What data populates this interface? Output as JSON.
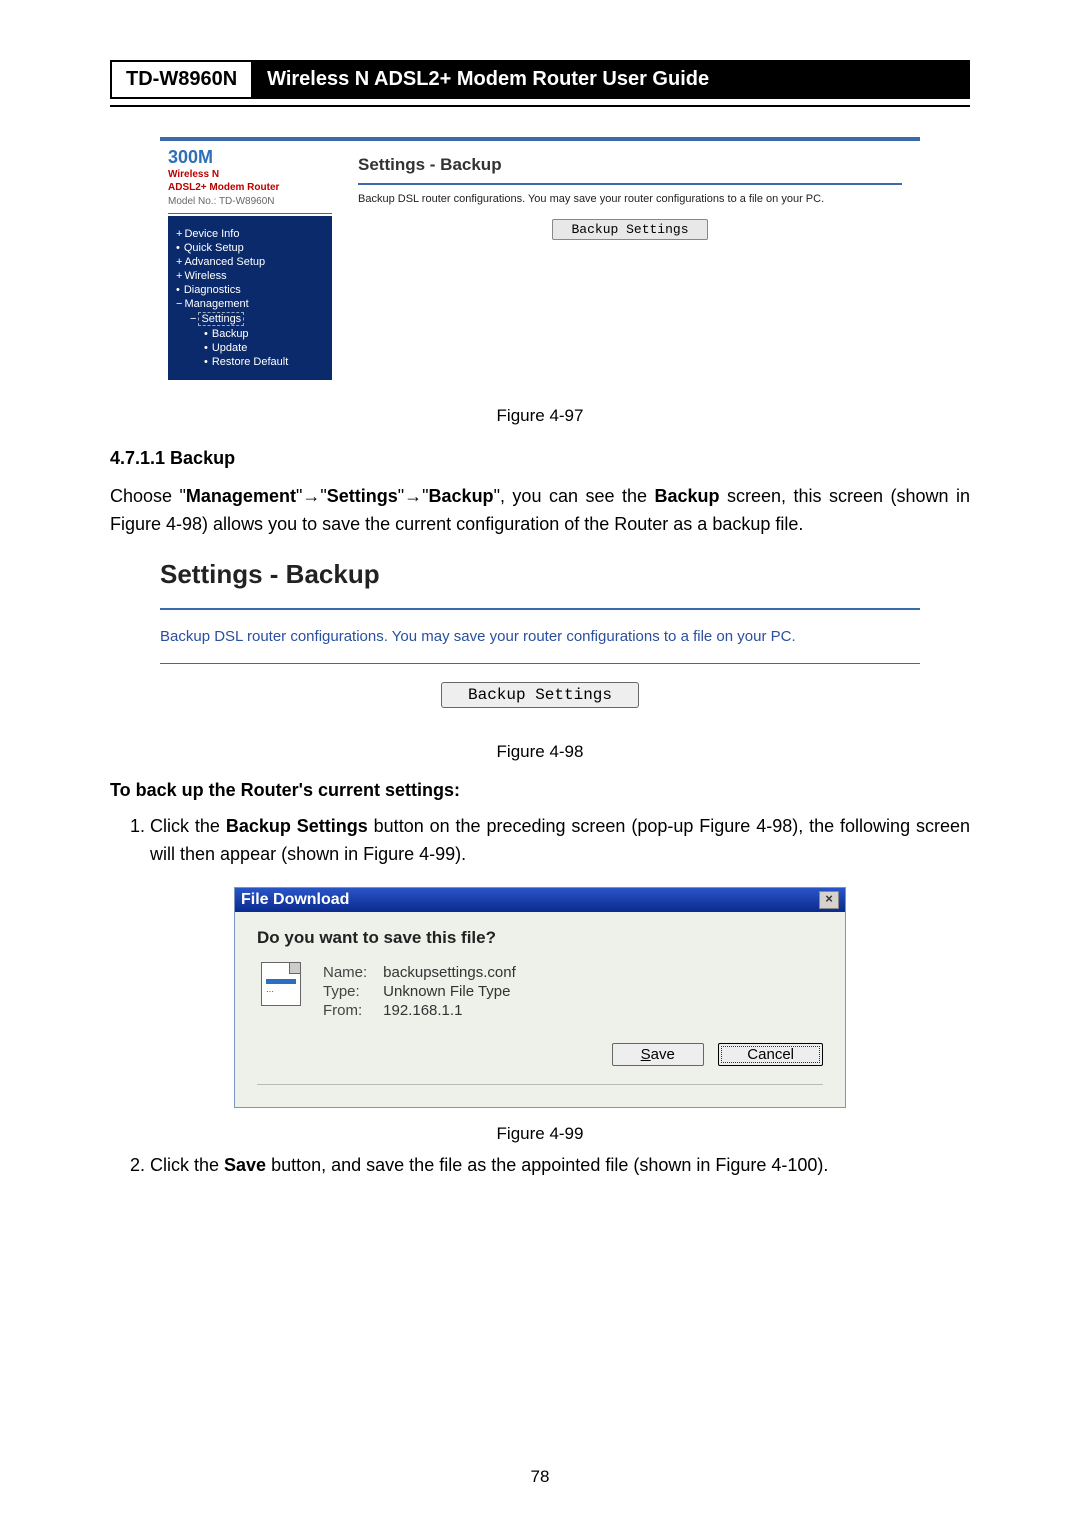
{
  "header": {
    "model": "TD-W8960N",
    "title": "Wireless  N  ADSL2+  Modem  Router  User  Guide"
  },
  "router_ui": {
    "brand": "300M",
    "sub1": "Wireless N",
    "sub2": "ADSL2+ Modem Router",
    "model_line": "Model No.: TD-W8960N",
    "nav": {
      "device_info": "Device Info",
      "quick_setup": "Quick Setup",
      "advanced_setup": "Advanced Setup",
      "wireless": "Wireless",
      "diagnostics": "Diagnostics",
      "management": "Management",
      "settings": "Settings",
      "backup": "Backup",
      "update": "Update",
      "restore_default": "Restore Default"
    },
    "page_title": "Settings - Backup",
    "page_desc": "Backup DSL router configurations. You may save your router configurations to a file on your PC.",
    "btn": "Backup Settings"
  },
  "captions": {
    "fig97": "Figure 4-97",
    "fig98": "Figure 4-98",
    "fig99": "Figure 4-99"
  },
  "section": {
    "num": "4.7.1.1   Backup",
    "para1_a": "Choose  \"",
    "para1_mgmt": "Management",
    "para1_b": "\"→\"",
    "para1_settings": "Settings",
    "para1_c": "\"→\"",
    "para1_backup": "Backup",
    "para1_d": "\",  you  can  see  the  ",
    "para1_backup2": "Backup",
    "para1_e": "  screen,  this  screen (shown in Figure 4-98) allows you to save the current configuration of the Router as a backup file."
  },
  "settings_panel": {
    "title": "Settings - Backup",
    "desc": "Backup DSL router configurations. You may save your router configurations to a file on your PC.",
    "btn": "Backup Settings"
  },
  "instr": {
    "title": "To back up the Router's current settings:",
    "step1_a": "Click  the  ",
    "step1_b": "Backup  Settings",
    "step1_c": "  button  on  the  preceding  screen  (pop-up  Figure  4-98),  the following screen will then appear (shown in Figure 4-99).",
    "step2_a": "Click the ",
    "step2_b": "Save",
    "step2_c": " button, and save the file as the appointed file (shown in Figure 4-100)."
  },
  "dialog": {
    "title": "File Download",
    "question": "Do you want to save this file?",
    "name_label": "Name:",
    "name_value": "backupsettings.conf",
    "type_label": "Type:",
    "type_value": "Unknown File Type",
    "from_label": "From:",
    "from_value": "192.168.1.1",
    "save": "Save",
    "cancel": "Cancel"
  },
  "page_number": "78"
}
